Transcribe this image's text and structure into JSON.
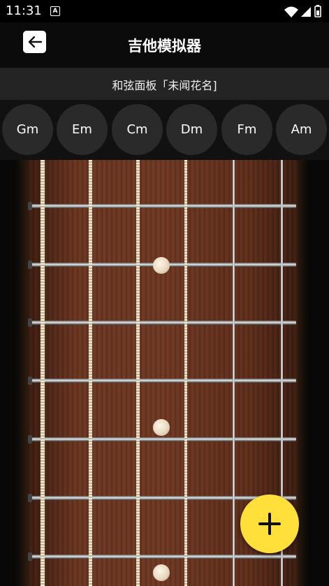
{
  "status_bar": {
    "time": "11:31",
    "notification_letter": "A"
  },
  "header": {
    "title": "吉他模拟器"
  },
  "panel": {
    "label": "和弦面板「未闻花名]"
  },
  "chords": [
    "Gm",
    "Em",
    "Cm",
    "Dm",
    "Fm",
    "Am"
  ],
  "colors": {
    "background": "#0b0b0b",
    "panel_bar": "#242424",
    "chord_button": "#2a2a2a",
    "fab": "#ffdf3a",
    "fretboard_wood": "#6e3722"
  },
  "icons": {
    "back": "arrow-left-icon",
    "fab": "plus-icon",
    "wifi": "wifi-icon",
    "signal": "signal-icon",
    "battery": "battery-icon"
  }
}
